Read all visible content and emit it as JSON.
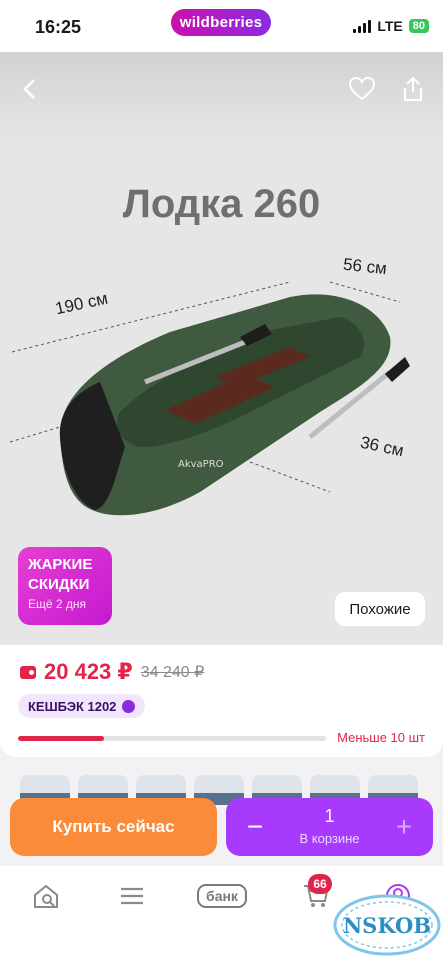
{
  "status_bar": {
    "time": "16:25",
    "network": "LTE",
    "battery": "80"
  },
  "brand": "wildberries",
  "product": {
    "title": "Лодка 260",
    "dimensions": {
      "length": "190 см",
      "width": "56 см",
      "tube": "36 см"
    },
    "boat_label": "AkvaPRO"
  },
  "promo": {
    "title": "ЖАРКИЕ СКИДКИ",
    "subtitle": "Ещё 2 дня"
  },
  "similar_label": "Похожие",
  "price": {
    "current": "20 423 ₽",
    "old": "34 240 ₽"
  },
  "cashback": "КЕШБЭК 1202",
  "stock": {
    "label": "Меньше 10 шт",
    "fill_percent": 28
  },
  "actions": {
    "buy_now": "Купить сейчас",
    "quantity": "1",
    "in_cart": "В корзине",
    "minus": "−",
    "plus": "+"
  },
  "tabbar": {
    "bank": "банк",
    "cart_count": "66"
  },
  "watermark": "NSKOB",
  "icons": [
    "back-arrow-icon",
    "heart-icon",
    "share-icon",
    "home-search-icon",
    "menu-icon",
    "cart-icon",
    "profile-icon"
  ],
  "colors": {
    "brand": "#cb11ab",
    "price": "#e1254a",
    "buy": "#f98b3a",
    "cart": "#a73afd"
  }
}
